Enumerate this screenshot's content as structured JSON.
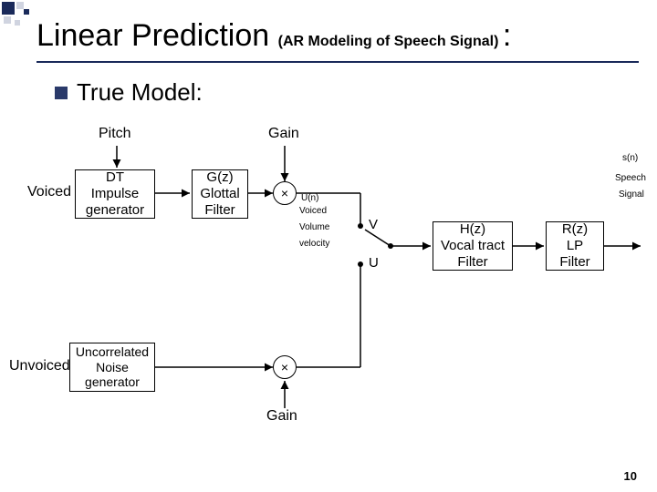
{
  "title": {
    "main": "Linear Prediction ",
    "sub": "(AR Modeling of Speech Signal)",
    "colon": ":"
  },
  "bullet": {
    "text": "True Model:"
  },
  "labels": {
    "pitch": "Pitch",
    "gain_top": "Gain",
    "gain_bottom": "Gain",
    "voiced": "Voiced",
    "unvoiced": "Unvoiced",
    "sn": "s(n)",
    "speech": "Speech",
    "signal": "Signal",
    "un": "U(n)",
    "voiced_small": "Voiced",
    "volume": "Volume",
    "velocity": "velocity",
    "v": "V",
    "u": "U"
  },
  "blocks": {
    "dt": {
      "l1": "DT",
      "l2": "Impulse",
      "l3": "generator"
    },
    "glottal": {
      "l1": "G(z)",
      "l2": "Glottal",
      "l3": "Filter"
    },
    "noise": {
      "l1": "Uncorrelated",
      "l2": "Noise",
      "l3": "generator"
    },
    "vt": {
      "l1": "H(z)",
      "l2": "Vocal tract",
      "l3": "Filter"
    },
    "lp": {
      "l1": "R(z)",
      "l2": "LP",
      "l3": "Filter"
    }
  },
  "mult_symbol": "×",
  "page_number": "10"
}
